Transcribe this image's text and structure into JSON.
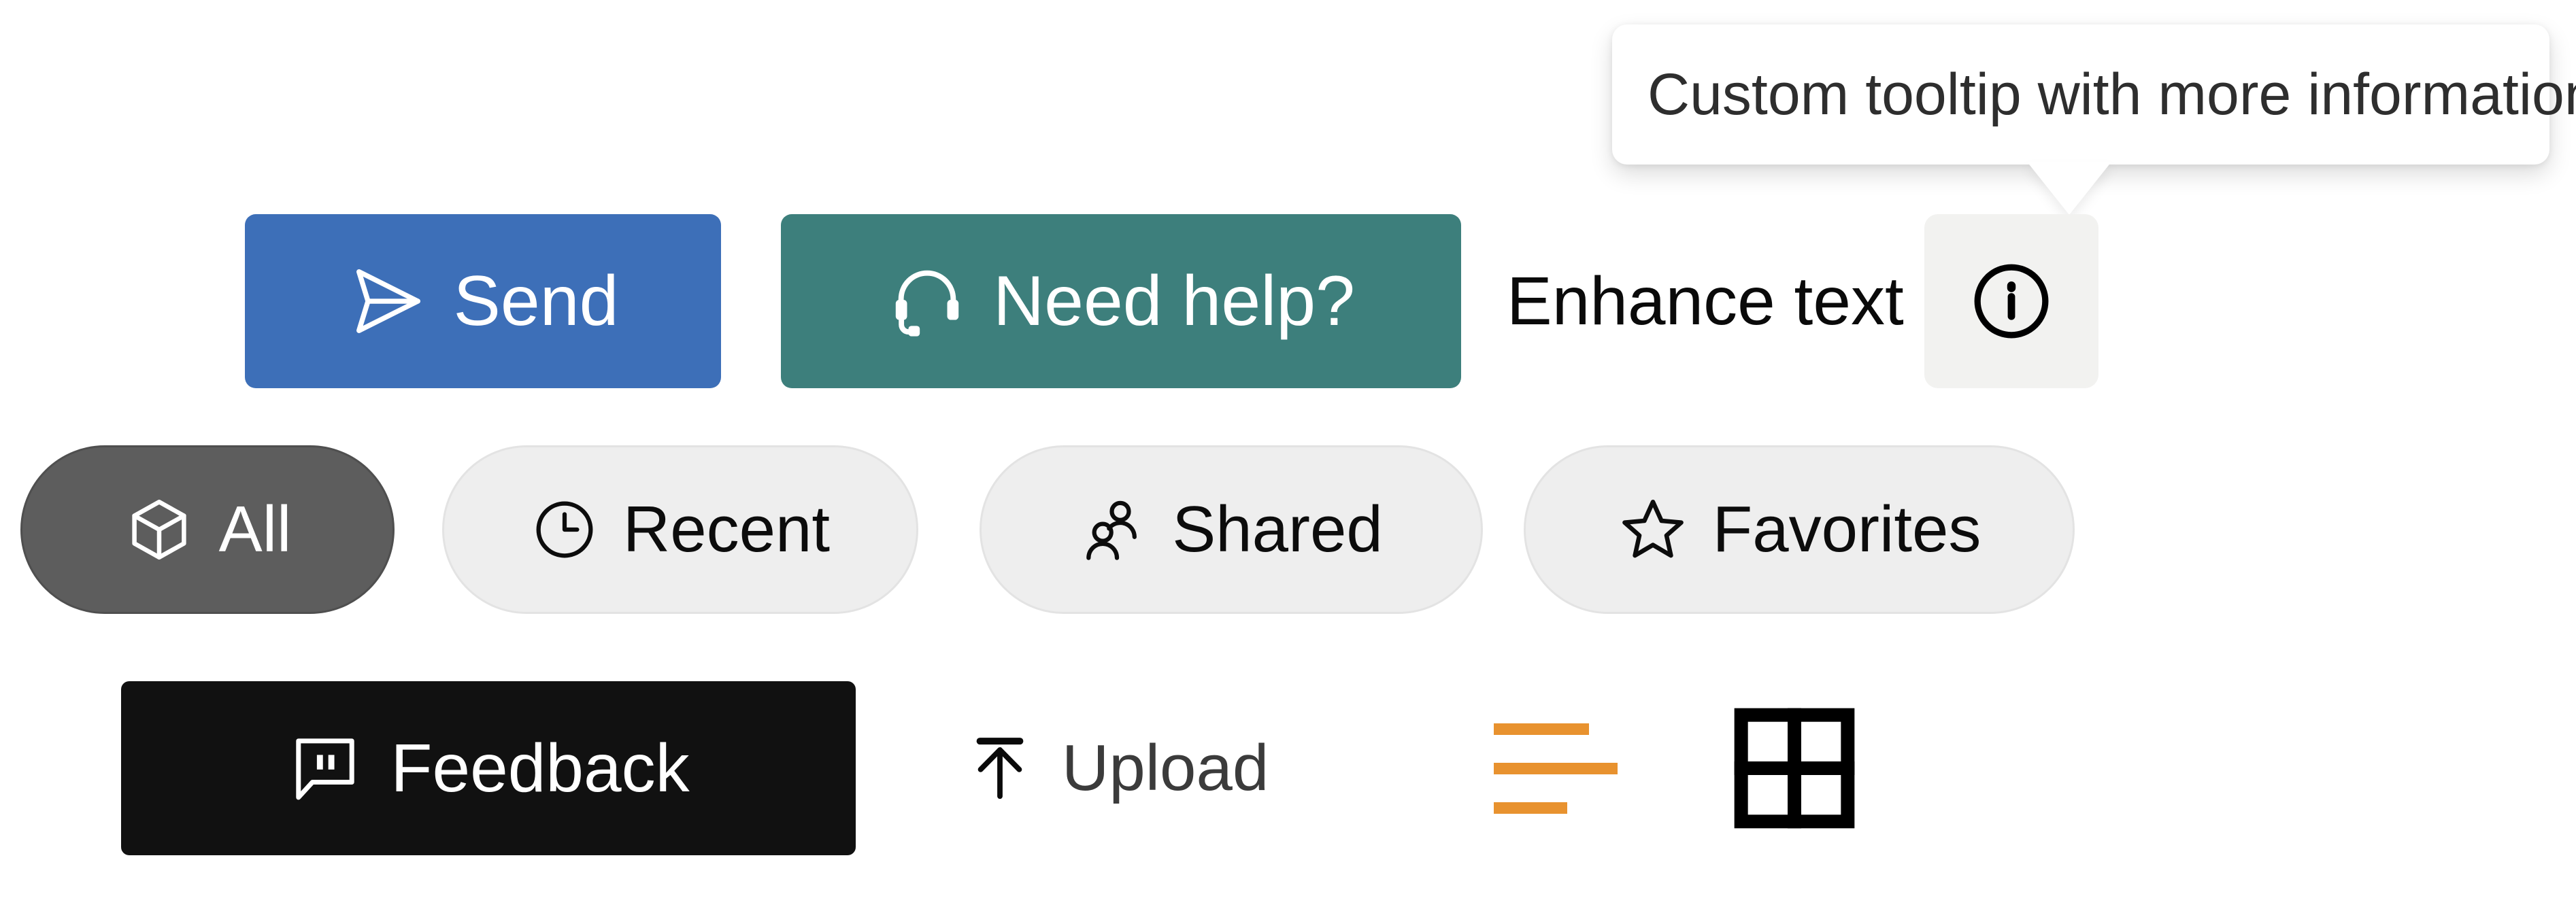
{
  "tooltip": {
    "text": "Custom tooltip with more information",
    "background": "#ffffff",
    "text_color": "#2e2e2e",
    "pointer": "down"
  },
  "actions": {
    "send": {
      "label": "Send",
      "icon": "send-paper-plane-icon",
      "background": "#3d6fb8",
      "text_color": "#ffffff"
    },
    "help": {
      "label": "Need help?",
      "icon": "headset-icon",
      "background": "#3d7f7c",
      "text_color": "#ffffff"
    },
    "enhance": {
      "label": "Enhance text",
      "text_color": "#0a0a0a",
      "info_icon": "info-circle-icon",
      "info_background": "#f2f2f0"
    }
  },
  "filters": {
    "items": [
      {
        "label": "All",
        "icon": "cube-icon",
        "active": true,
        "background": "#5d5d5d",
        "text_color": "#ffffff"
      },
      {
        "label": "Recent",
        "icon": "clock-icon",
        "active": false,
        "background": "#eeeeee",
        "text_color": "#0c0c0c"
      },
      {
        "label": "Shared",
        "icon": "people-icon",
        "active": false,
        "background": "#eeeeee",
        "text_color": "#0c0c0c"
      },
      {
        "label": "Favorites",
        "icon": "star-icon",
        "active": false,
        "background": "#eeeeee",
        "text_color": "#0c0c0c"
      }
    ]
  },
  "toolbar": {
    "feedback": {
      "label": "Feedback",
      "icon": "comment-quote-icon",
      "background": "#111111",
      "text_color": "#ffffff"
    },
    "upload": {
      "label": "Upload",
      "icon": "arrow-up-to-line-icon",
      "text_color": "#3b3b3b"
    },
    "list_view": {
      "icon": "align-left-lines-icon",
      "color": "#e8922f"
    },
    "grid_view": {
      "icon": "grid-2x2-icon",
      "color": "#000000"
    }
  }
}
